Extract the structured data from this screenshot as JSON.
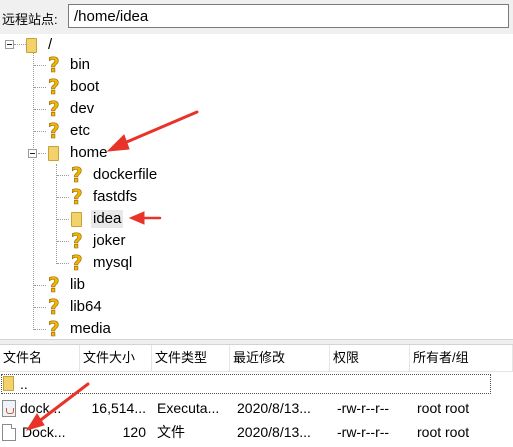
{
  "address_bar": {
    "label": "远程站点:",
    "value": "/home/idea"
  },
  "tree": {
    "root": "/",
    "items": [
      {
        "label": "bin"
      },
      {
        "label": "boot"
      },
      {
        "label": "dev"
      },
      {
        "label": "etc"
      },
      {
        "label": "home",
        "children": [
          {
            "label": "dockerfile"
          },
          {
            "label": "fastdfs"
          },
          {
            "label": "idea"
          },
          {
            "label": "joker"
          },
          {
            "label": "mysql"
          }
        ]
      },
      {
        "label": "lib"
      },
      {
        "label": "lib64"
      },
      {
        "label": "media"
      }
    ]
  },
  "file_list": {
    "columns": [
      "文件名",
      "文件大小",
      "文件类型",
      "最近修改",
      "权限",
      "所有者/组"
    ],
    "rows": [
      {
        "name": "..",
        "size": "",
        "type": "",
        "modified": "",
        "perms": "",
        "owner": ""
      },
      {
        "name": "dock...",
        "size": "16,514...",
        "type": "Executa...",
        "modified": "2020/8/13...",
        "perms": "-rw-r--r--",
        "owner": "root root",
        "icon": "java-file-icon"
      },
      {
        "name": "Dock...",
        "size": "120",
        "type": "文件",
        "modified": "2020/8/13...",
        "perms": "-rw-r--r--",
        "owner": "root root",
        "icon": "generic-file-icon"
      }
    ]
  },
  "colors": {
    "annotation_arrow": "#e8332a",
    "folder": "#f4d26b",
    "unknown_icon": "#f5b400"
  }
}
